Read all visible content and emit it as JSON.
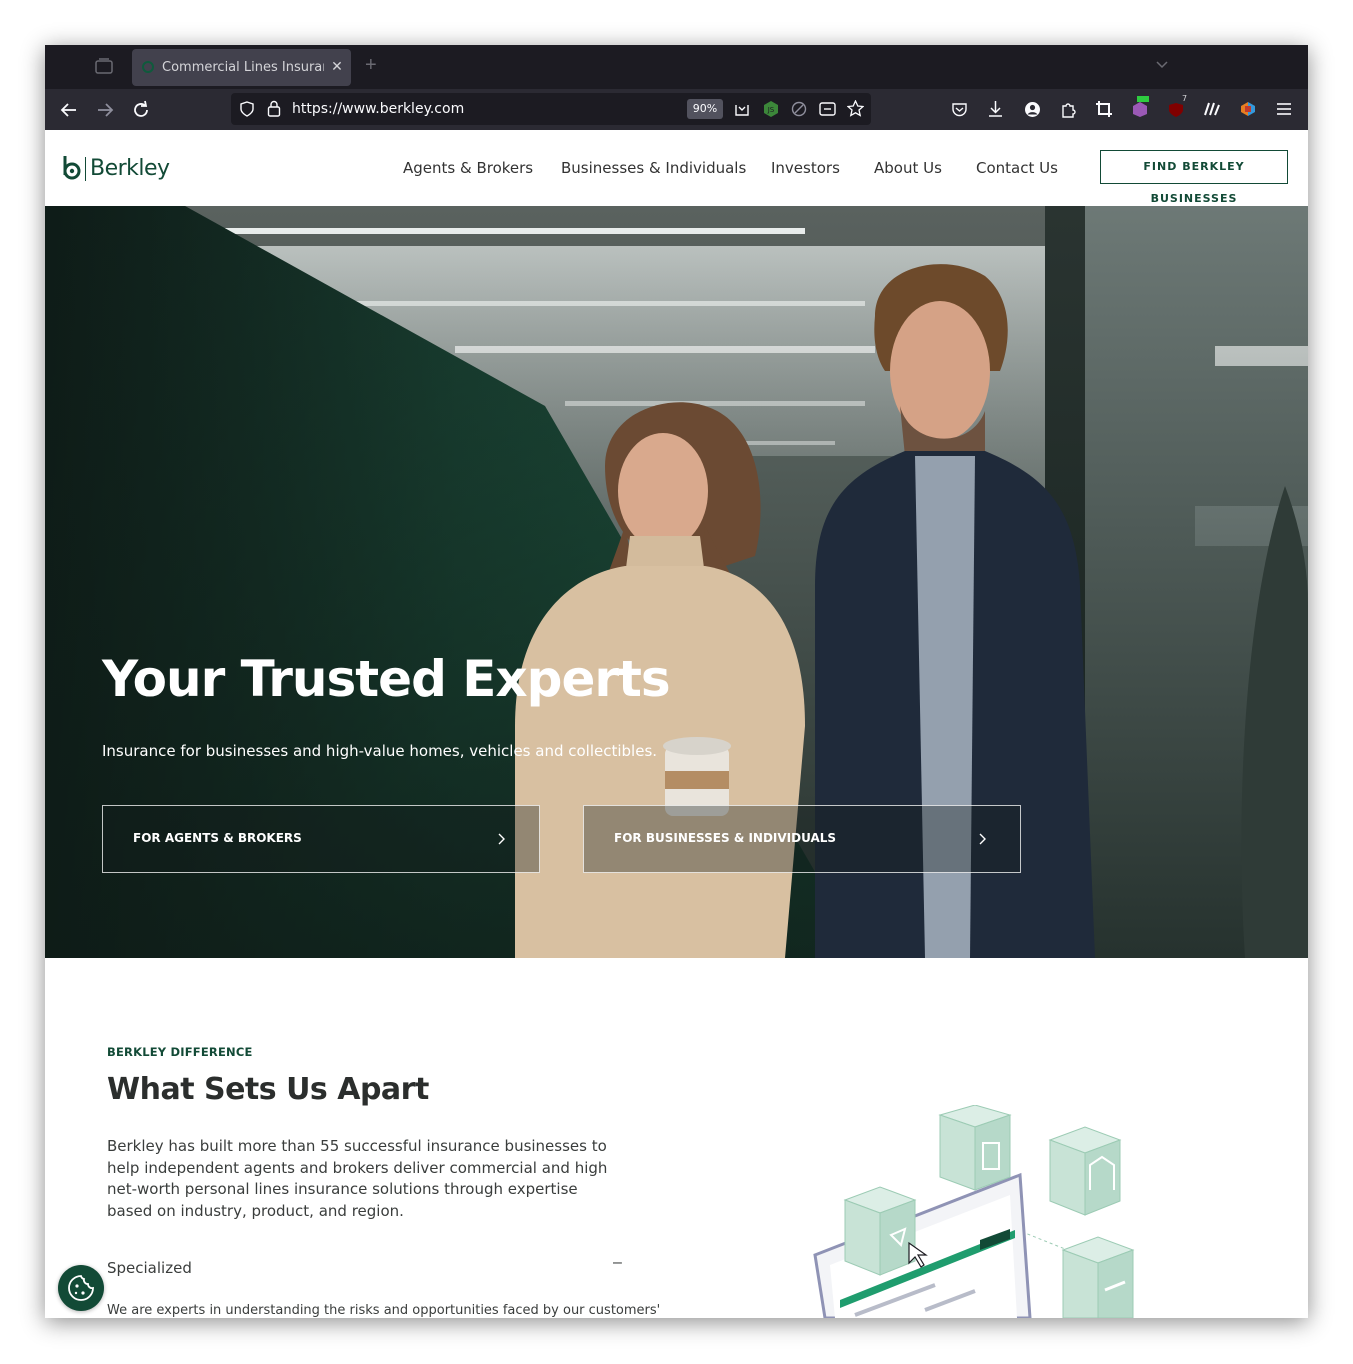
{
  "browser": {
    "tab_title": "Commercial Lines Insurance",
    "url": "https://www.berkley.com",
    "zoom": "90%",
    "extension_badge": "7"
  },
  "site": {
    "logo_text": "Berkley",
    "nav": [
      "Agents & Brokers",
      "Businesses & Individuals",
      "Investors",
      "About Us",
      "Contact Us"
    ],
    "cta": "FIND BERKLEY BUSINESSES"
  },
  "hero": {
    "title": "Your Trusted Experts",
    "subtitle": "Insurance for businesses and high-value homes, vehicles and collectibles.",
    "buttons": [
      "FOR AGENTS & BROKERS",
      "FOR BUSINESSES & INDIVIDUALS"
    ]
  },
  "difference": {
    "eyebrow": "BERKLEY DIFFERENCE",
    "title": "What Sets Us Apart",
    "body": "Berkley has built more than 55 successful insurance businesses to help independent agents and brokers deliver commercial and high net-worth personal lines insurance solutions through expertise based on industry, product, and region.",
    "accordion": {
      "title": "Specialized",
      "toggle": "–",
      "body": "We are experts in understanding the risks and opportunities faced by our customers'"
    }
  },
  "colors": {
    "brand_green": "#124a36",
    "hero_green": "#1f5a43",
    "tab_bg": "#42414d",
    "toolbar_bg": "#2b2a33"
  }
}
